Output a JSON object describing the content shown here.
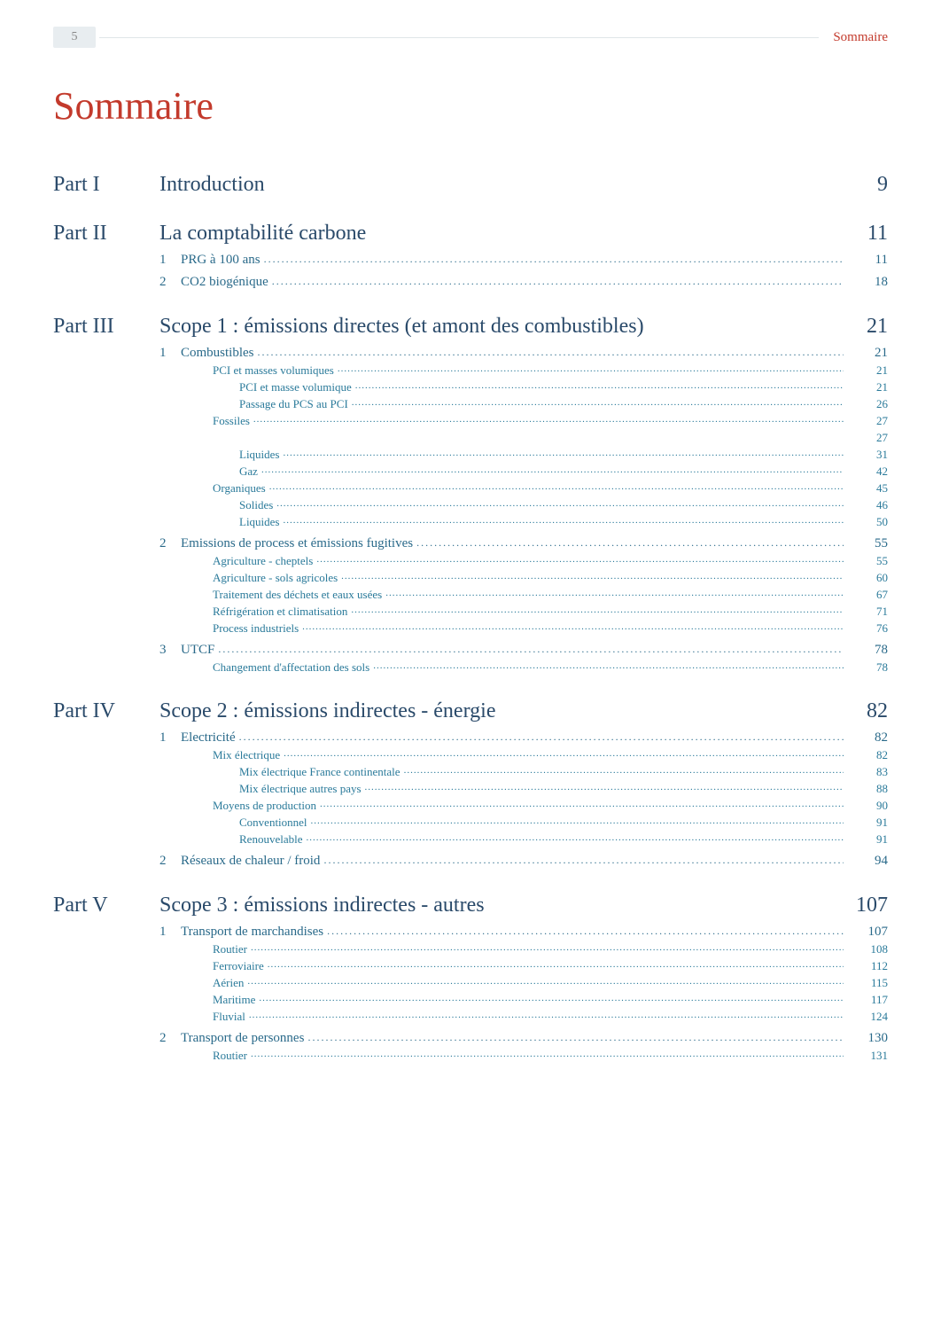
{
  "header": {
    "page_number": "5",
    "label": "Sommaire"
  },
  "title": "Sommaire",
  "parts": [
    {
      "label": "Part I",
      "title": "Introduction",
      "page": "9",
      "sections": []
    },
    {
      "label": "Part II",
      "title": "La comptabilité carbone",
      "page": "11",
      "sections": [
        {
          "num": "1",
          "title": "PRG à 100 ans",
          "page": "11",
          "subs": []
        },
        {
          "num": "2",
          "title": "CO2 biogénique",
          "page": "18",
          "subs": []
        }
      ]
    },
    {
      "label": "Part III",
      "title": "Scope 1 : émissions directes (et amont des combustibles)",
      "page": "21",
      "sections": [
        {
          "num": "1",
          "title": "Combustibles",
          "page": "21",
          "subs": [
            {
              "level": 1,
              "title": "PCI et masses volumiques",
              "page": "21"
            },
            {
              "level": 2,
              "title": "PCI et masse volumique",
              "page": "21"
            },
            {
              "level": 2,
              "title": "Passage du PCS au PCI",
              "page": "26"
            },
            {
              "level": 1,
              "title": "Fossiles",
              "page": "27"
            },
            {
              "level": 2,
              "title": "",
              "page": "27"
            },
            {
              "level": 2,
              "title": "Liquides",
              "page": "31"
            },
            {
              "level": 2,
              "title": "Gaz",
              "page": "42"
            },
            {
              "level": 1,
              "title": "Organiques",
              "page": "45"
            },
            {
              "level": 2,
              "title": "Solides",
              "page": "46"
            },
            {
              "level": 2,
              "title": "Liquides",
              "page": "50"
            }
          ]
        },
        {
          "num": "2",
          "title": "Emissions de process et émissions fugitives",
          "page": "55",
          "subs": [
            {
              "level": 1,
              "title": "Agriculture - cheptels",
              "page": "55"
            },
            {
              "level": 1,
              "title": "Agriculture - sols agricoles",
              "page": "60"
            },
            {
              "level": 1,
              "title": "Traitement des déchets et eaux usées",
              "page": "67"
            },
            {
              "level": 1,
              "title": "Réfrigération et climatisation",
              "page": "71"
            },
            {
              "level": 1,
              "title": "Process industriels",
              "page": "76"
            }
          ]
        },
        {
          "num": "3",
          "title": "UTCF",
          "page": "78",
          "subs": [
            {
              "level": 1,
              "title": "Changement d'affectation des sols",
              "page": "78"
            }
          ]
        }
      ]
    },
    {
      "label": "Part IV",
      "title": "Scope 2 : émissions indirectes - énergie",
      "page": "82",
      "sections": [
        {
          "num": "1",
          "title": "Electricité",
          "page": "82",
          "subs": [
            {
              "level": 1,
              "title": "Mix électrique",
              "page": "82"
            },
            {
              "level": 2,
              "title": "Mix électrique France continentale",
              "page": "83"
            },
            {
              "level": 2,
              "title": "Mix électrique autres pays",
              "page": "88"
            },
            {
              "level": 1,
              "title": "Moyens de production",
              "page": "90"
            },
            {
              "level": 2,
              "title": "Conventionnel",
              "page": "91"
            },
            {
              "level": 2,
              "title": "Renouvelable",
              "page": "91"
            }
          ]
        },
        {
          "num": "2",
          "title": "Réseaux de chaleur / froid",
          "page": "94",
          "subs": []
        }
      ]
    },
    {
      "label": "Part V",
      "title": "Scope 3 : émissions indirectes - autres",
      "page": "107",
      "sections": [
        {
          "num": "1",
          "title": "Transport de marchandises",
          "page": "107",
          "subs": [
            {
              "level": 1,
              "title": "Routier",
              "page": "108"
            },
            {
              "level": 1,
              "title": "Ferroviaire",
              "page": "112"
            },
            {
              "level": 1,
              "title": "Aérien",
              "page": "115"
            },
            {
              "level": 1,
              "title": "Maritime",
              "page": "117"
            },
            {
              "level": 1,
              "title": "Fluvial",
              "page": "124"
            }
          ]
        },
        {
          "num": "2",
          "title": "Transport de personnes",
          "page": "130",
          "subs": [
            {
              "level": 1,
              "title": "Routier",
              "page": "131"
            }
          ]
        }
      ]
    }
  ]
}
